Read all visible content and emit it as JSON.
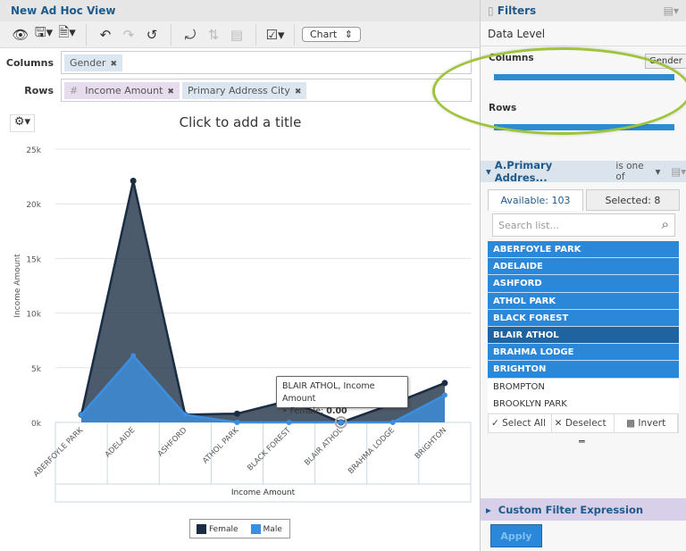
{
  "header": {
    "title": "New Ad Hoc View"
  },
  "toolbar": {
    "view_select": "Chart",
    "icons": [
      "eye-icon",
      "save-icon",
      "export-icon",
      "undo-icon",
      "redo-icon",
      "reset-icon",
      "switch-axes-icon",
      "sort-icon",
      "table-icon",
      "options-icon"
    ]
  },
  "columns": {
    "label": "Columns",
    "pills": [
      {
        "label": "Gender"
      }
    ]
  },
  "rows": {
    "label": "Rows",
    "pills": [
      {
        "label": "Income Amount",
        "prefix": "#"
      },
      {
        "label": "Primary Address City"
      }
    ]
  },
  "chart_title": "Click to add a title",
  "tooltip": {
    "title": "BLAIR ATHOL, Income Amount",
    "series": "Female:",
    "value": "0.00"
  },
  "chart_data": {
    "type": "area",
    "categories": [
      "ABERFOYLE PARK",
      "ADELAIDE",
      "ASHFORD",
      "ATHOL PARK",
      "BLACK FOREST",
      "BLAIR ATHOL",
      "BRAHMA LODGE",
      "BRIGHTON"
    ],
    "series": [
      {
        "name": "Female",
        "color": "#1a2d42",
        "values": [
          700,
          22100,
          700,
          800,
          2000,
          0,
          1700,
          3600
        ]
      },
      {
        "name": "Male",
        "color": "#3d8ee0",
        "values": [
          700,
          6100,
          700,
          0,
          0,
          0,
          0,
          2500
        ]
      }
    ],
    "ylabel": "Income Amount",
    "xlabel": "Income Amount",
    "yticks": [
      "0k",
      "5k",
      "10k",
      "15k",
      "20k",
      "25k"
    ],
    "ylim": [
      0,
      25000
    ],
    "grid": true,
    "legend": "bottom"
  },
  "filters": {
    "title": "Filters",
    "data_level": "Data Level",
    "columns_label": "Columns",
    "rows_label": "Rows",
    "gender_button": "Gender",
    "filter_name": "A.Primary Addres...",
    "operator": "is one of",
    "available": "Available: 103",
    "selected": "Selected: 8",
    "search_placeholder": "Search list...",
    "items": [
      {
        "label": "ABERFOYLE PARK",
        "state": "selected"
      },
      {
        "label": "ADELAIDE",
        "state": "selected"
      },
      {
        "label": "ASHFORD",
        "state": "selected"
      },
      {
        "label": "ATHOL PARK",
        "state": "selected"
      },
      {
        "label": "BLACK FOREST",
        "state": "selected"
      },
      {
        "label": "BLAIR ATHOL",
        "state": "highlighted"
      },
      {
        "label": "BRAHMA LODGE",
        "state": "selected"
      },
      {
        "label": "BRIGHTON",
        "state": "selected"
      },
      {
        "label": "BROMPTON",
        "state": "unselected"
      },
      {
        "label": "BROOKLYN PARK",
        "state": "unselected"
      }
    ],
    "select_all": "Select All",
    "deselect": "Deselect",
    "invert": "Invert",
    "custom_expr": "Custom Filter Expression",
    "apply": "Apply"
  }
}
